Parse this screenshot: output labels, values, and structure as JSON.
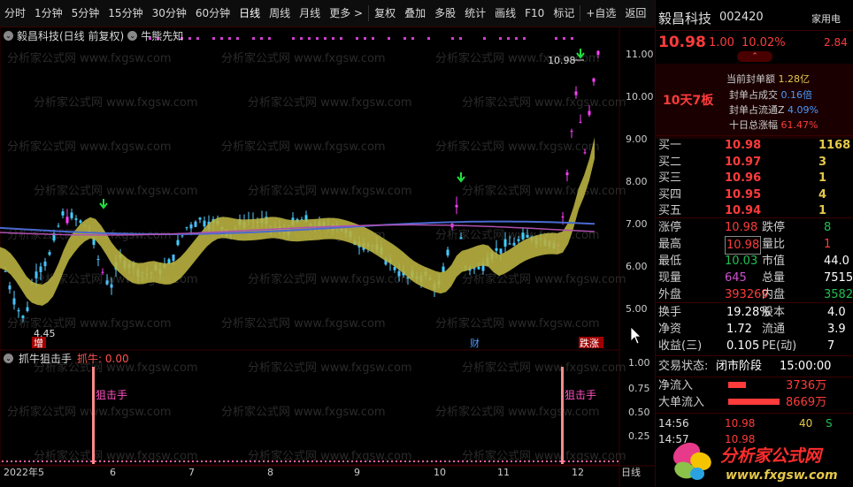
{
  "toolbar": {
    "items": [
      "分时",
      "1分钟",
      "5分钟",
      "15分钟",
      "30分钟",
      "60分钟",
      "日线",
      "周线",
      "月线",
      "更多 >",
      "复权",
      "叠加",
      "多股",
      "统计",
      "画线",
      "F10",
      "标记",
      "+自选",
      "返回"
    ],
    "active": "日线"
  },
  "chart": {
    "title_stock": "毅昌科技(日线 前复权)",
    "indicator_main": "牛熊先知",
    "watermark": "分析家公式网 www.fxgsw.com",
    "price_labels": [
      "11.00",
      "10.00",
      "9.00",
      "8.00",
      "7.00",
      "6.00",
      "5.00"
    ],
    "high_label": "10.98",
    "low_label": "4.45",
    "date_labels": [
      "2022年5",
      "6",
      "7",
      "8",
      "9",
      "10",
      "11",
      "12",
      "日线"
    ],
    "tags": {
      "zeng": "增",
      "cai": "财",
      "diezhang": "跌涨"
    },
    "sub_indicator": "抓牛狙击手",
    "sub_value_label": "抓牛: 0.00",
    "sub_labels": [
      "1.00",
      "0.75",
      "0.50",
      "0.25"
    ],
    "sniper_label": "狙击手"
  },
  "quote": {
    "name": "毅昌科技",
    "code": "002420",
    "tag": "家用电",
    "price": "10.98",
    "change": "1.00",
    "pct": "10.02%",
    "side_val": "2.84",
    "board": "10天7板",
    "seal_amount_label": "当前封单额",
    "seal_amount": "1.28亿",
    "seal_ratio_label": "封单占成交",
    "seal_ratio": "0.16倍",
    "seal_float_label": "封单占流通Z",
    "seal_float": "4.09%",
    "ten_day_label": "十日总涨幅",
    "ten_day": "61.47%",
    "buy": [
      {
        "label": "买一",
        "price": "10.98",
        "vol": "1168"
      },
      {
        "label": "买二",
        "price": "10.97",
        "vol": "3"
      },
      {
        "label": "买三",
        "price": "10.96",
        "vol": "1"
      },
      {
        "label": "买四",
        "price": "10.95",
        "vol": "4"
      },
      {
        "label": "买五",
        "price": "10.94",
        "vol": "1"
      }
    ],
    "stats": [
      {
        "l1": "涨停",
        "v1": "10.98",
        "l2": "跌停",
        "v2": "8"
      },
      {
        "l1": "最高",
        "v1": "10.98",
        "l2": "量比",
        "v2": "1"
      },
      {
        "l1": "最低",
        "v1": "10.03",
        "l2": "市值",
        "v2": "44.0"
      },
      {
        "l1": "现量",
        "v1": "645",
        "l2": "总量",
        "v2": "7515"
      },
      {
        "l1": "外盘",
        "v1": "393269",
        "l2": "内盘",
        "v2": "3582"
      }
    ],
    "fund": [
      {
        "l1": "换手",
        "v1": "19.28%",
        "l2": "股本",
        "v2": "4.0"
      },
      {
        "l1": "净资",
        "v1": "1.72",
        "l2": "流通",
        "v2": "3.9"
      },
      {
        "l1": "收益(三)",
        "v1": "0.105",
        "l2": "PE(动)",
        "v2": "7"
      }
    ],
    "trade_status_label": "交易状态:",
    "trade_status": "闭市阶段",
    "trade_time": "15:00:00",
    "net_in_label": "净流入",
    "net_in": "3736万",
    "big_in_label": "大单流入",
    "big_in": "8669万",
    "ticks": [
      {
        "t": "14:56",
        "p": "10.98",
        "v": "40",
        "s": "S"
      },
      {
        "t": "14:57",
        "p": "10.98",
        "v": "",
        "s": ""
      }
    ]
  },
  "logo": {
    "text": "分析家公式网",
    "url": "www.fxgsw.com"
  }
}
